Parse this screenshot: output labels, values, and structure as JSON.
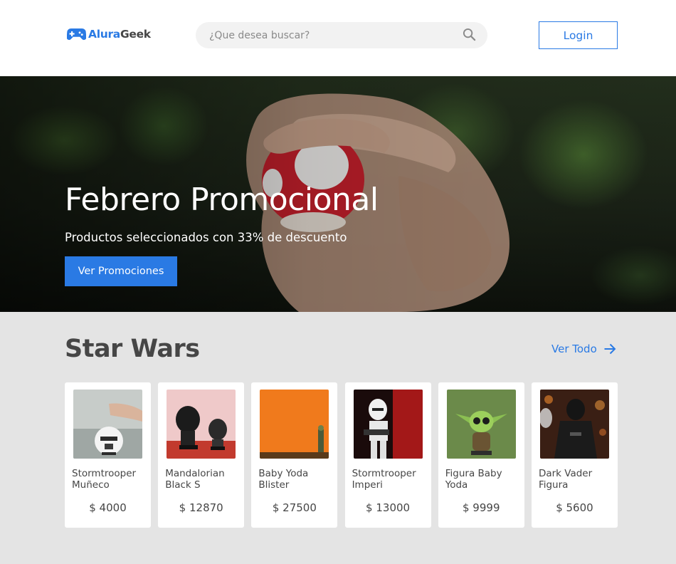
{
  "header": {
    "logo_part1": "Alura",
    "logo_part2": "Geek",
    "search_placeholder": "¿Que desea buscar?",
    "login_label": "Login"
  },
  "hero": {
    "title": "Febrero Promocional",
    "subtitle": "Productos seleccionados con 33% de descuento",
    "button_label": "Ver Promociones"
  },
  "section": {
    "title": "Star Wars",
    "see_all_label": "Ver Todo"
  },
  "products": [
    {
      "name": "Stormtrooper Muñeco",
      "price": "$ 4000"
    },
    {
      "name": "Mandalorian Black S",
      "price": "$ 12870"
    },
    {
      "name": "Baby Yoda Blister",
      "price": "$ 27500"
    },
    {
      "name": "Stormtrooper Imperi",
      "price": "$ 13000"
    },
    {
      "name": "Figura Baby Yoda",
      "price": "$ 9999"
    },
    {
      "name": "Dark Vader Figura",
      "price": "$ 5600"
    }
  ],
  "colors": {
    "accent": "#2a7ae4",
    "text": "#464646",
    "section_bg": "#e4e4e4",
    "search_bg": "#f2f2f2"
  }
}
